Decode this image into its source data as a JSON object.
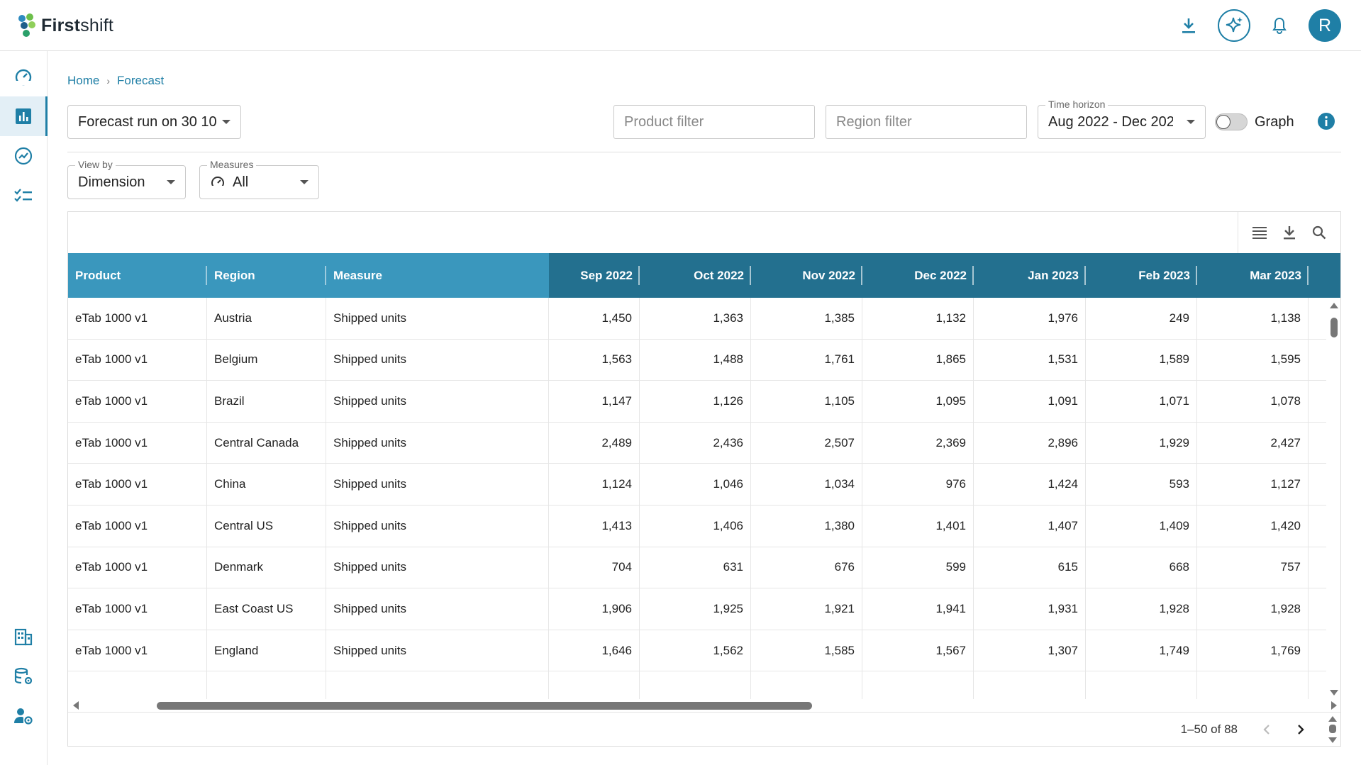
{
  "app": {
    "name_bold": "First",
    "name_rest": "shift",
    "avatar_initial": "R",
    "brand_color": "#1f7fa6"
  },
  "topbar": {
    "icons": [
      "download-icon",
      "ai-sparkle-icon",
      "bell-icon",
      "avatar"
    ]
  },
  "sidebar": {
    "items": [
      {
        "icon": "dashboard-gauge-icon",
        "active": false
      },
      {
        "icon": "bar-chart-icon",
        "active": true
      },
      {
        "icon": "trend-chart-icon",
        "active": false
      },
      {
        "icon": "checklist-icon",
        "active": false
      },
      {
        "icon": "building-icon",
        "active": false
      },
      {
        "icon": "database-settings-icon",
        "active": false
      },
      {
        "icon": "user-settings-icon",
        "active": false
      }
    ]
  },
  "breadcrumb": {
    "home": "Home",
    "separator": "›",
    "current": "Forecast"
  },
  "controls": {
    "forecast_run": "Forecast run on 30 10",
    "product_filter_placeholder": "Product filter",
    "region_filter_placeholder": "Region filter",
    "time_horizon_label": "Time horizon",
    "time_horizon_value": "Aug 2022 - Dec 202",
    "graph_label": "Graph",
    "graph_on": false,
    "view_by_label": "View by",
    "view_by_value": "Dimension",
    "measures_label": "Measures",
    "measures_value": "All"
  },
  "table": {
    "columns": [
      "Product",
      "Region",
      "Measure",
      "Sep 2022",
      "Oct 2022",
      "Nov 2022",
      "Dec 2022",
      "Jan 2023",
      "Feb 2023",
      "Mar 2023"
    ],
    "rows": [
      [
        "eTab 1000 v1",
        "Austria",
        "Shipped units",
        "1,450",
        "1,363",
        "1,385",
        "1,132",
        "1,976",
        "249",
        "1,138"
      ],
      [
        "eTab 1000 v1",
        "Belgium",
        "Shipped units",
        "1,563",
        "1,488",
        "1,761",
        "1,865",
        "1,531",
        "1,589",
        "1,595"
      ],
      [
        "eTab 1000 v1",
        "Brazil",
        "Shipped units",
        "1,147",
        "1,126",
        "1,105",
        "1,095",
        "1,091",
        "1,071",
        "1,078"
      ],
      [
        "eTab 1000 v1",
        "Central Canada",
        "Shipped units",
        "2,489",
        "2,436",
        "2,507",
        "2,369",
        "2,896",
        "1,929",
        "2,427"
      ],
      [
        "eTab 1000 v1",
        "China",
        "Shipped units",
        "1,124",
        "1,046",
        "1,034",
        "976",
        "1,424",
        "593",
        "1,127"
      ],
      [
        "eTab 1000 v1",
        "Central US",
        "Shipped units",
        "1,413",
        "1,406",
        "1,380",
        "1,401",
        "1,407",
        "1,409",
        "1,420"
      ],
      [
        "eTab 1000 v1",
        "Denmark",
        "Shipped units",
        "704",
        "631",
        "676",
        "599",
        "615",
        "668",
        "757"
      ],
      [
        "eTab 1000 v1",
        "East Coast US",
        "Shipped units",
        "1,906",
        "1,925",
        "1,921",
        "1,941",
        "1,931",
        "1,928",
        "1,928"
      ],
      [
        "eTab 1000 v1",
        "England",
        "Shipped units",
        "1,646",
        "1,562",
        "1,585",
        "1,567",
        "1,307",
        "1,749",
        "1,769"
      ]
    ],
    "toolbar_icons": [
      "columns-menu-icon",
      "download-icon",
      "search-icon"
    ],
    "header_light_color": "#3a97bd",
    "header_dark_color": "#23708f"
  },
  "pager": {
    "range": "1–50 of 88"
  }
}
